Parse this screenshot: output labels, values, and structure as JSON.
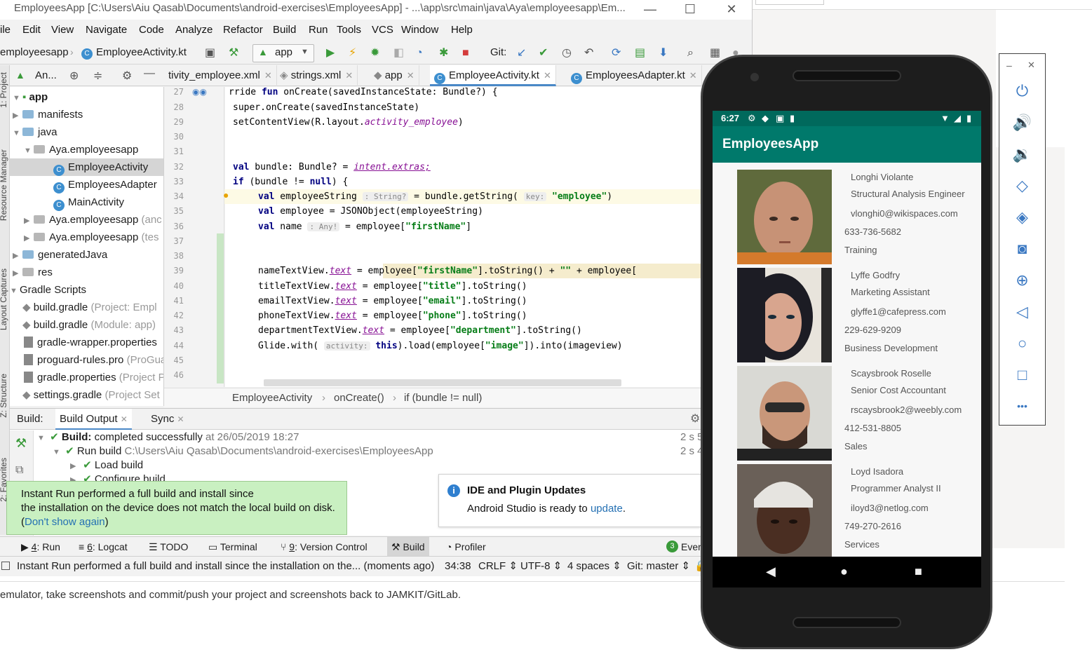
{
  "background": {
    "bottom_text": "emulator, take screenshots and commit/push your project and screenshots back to JAMKIT/GitLab."
  },
  "ide": {
    "title": "EmployeesApp [C:\\Users\\Aiu Qasab\\Documents\\android-exercises\\EmployeesApp] - ...\\app\\src\\main\\java\\Aya\\employeesapp\\Em...",
    "window_controls": {
      "minimize": "—",
      "maximize": "☐",
      "close": "✕"
    },
    "menu": [
      "ile",
      "Edit",
      "View",
      "Navigate",
      "Code",
      "Analyze",
      "Refactor",
      "Build",
      "Run",
      "Tools",
      "VCS",
      "Window",
      "Help"
    ],
    "toolbar": {
      "breadcrumb_root": "employeesapp",
      "breadcrumb_file": "EmployeeActivity.kt",
      "run_config": "app",
      "git_label": "Git:"
    },
    "editor_tabs": [
      {
        "label": "tivity_employee.xml",
        "active": false
      },
      {
        "label": "strings.xml",
        "active": false
      },
      {
        "label": "app",
        "active": false
      },
      {
        "label": "EmployeeActivity.kt",
        "active": true
      },
      {
        "label": "EmployeesAdapter.kt",
        "active": false
      }
    ],
    "project_pane": {
      "selector": "An...",
      "side_labels": [
        "1: Project",
        "Resource Manager",
        "Layout Captures",
        "Z: Structure",
        "2: Favorites"
      ],
      "tree": [
        {
          "label": "app",
          "hint": ""
        },
        {
          "label": "manifests",
          "hint": ""
        },
        {
          "label": "java",
          "hint": ""
        },
        {
          "label": "Aya.employeesapp",
          "hint": ""
        },
        {
          "label": "EmployeeActivity",
          "hint": ""
        },
        {
          "label": "EmployeesAdapter",
          "hint": ""
        },
        {
          "label": "MainActivity",
          "hint": ""
        },
        {
          "label": "Aya.employeesapp",
          "hint": "(anc"
        },
        {
          "label": "Aya.employeesapp",
          "hint": "(tes"
        },
        {
          "label": "generatedJava",
          "hint": ""
        },
        {
          "label": "res",
          "hint": ""
        },
        {
          "label": "Gradle Scripts",
          "hint": ""
        },
        {
          "label": "build.gradle",
          "hint": "(Project: Empl"
        },
        {
          "label": "build.gradle",
          "hint": "(Module: app)"
        },
        {
          "label": "gradle-wrapper.properties",
          "hint": ""
        },
        {
          "label": "proguard-rules.pro",
          "hint": "(ProGua"
        },
        {
          "label": "gradle.properties",
          "hint": "(Project P"
        },
        {
          "label": "settings.gradle",
          "hint": "(Project Set"
        }
      ]
    },
    "code": {
      "line_numbers": [
        "27",
        "28",
        "29",
        "30",
        "31",
        "32",
        "33",
        "34",
        "35",
        "36",
        "37",
        "38",
        "39",
        "40",
        "41",
        "42",
        "43",
        "44",
        "45",
        "46"
      ],
      "l27": {
        "a": "rride ",
        "kw": "fun",
        "b": " onCreate(savedInstanceState: Bundle?) {"
      },
      "l28": "super.onCreate(savedInstanceState)",
      "l29": {
        "a": "setContentView(R.layout.",
        "p": "activity_employee",
        "b": ")"
      },
      "l32": {
        "kw": "val",
        "a": " bundle: Bundle? = ",
        "p": "intent.extras;"
      },
      "l33": {
        "kw": "if",
        "a": " (bundle != ",
        "kw2": "null",
        "b": ") {"
      },
      "l34": {
        "kw": "val",
        "a": " employeeString ",
        "hint": ": String?",
        "b": " = bundle.getString( ",
        "hint2": "key:",
        "s": " \"employee\"",
        "c": ")"
      },
      "l35": {
        "kw": "val",
        "a": " employee = JSONObject(employeeString)"
      },
      "l36": {
        "kw": "val",
        "a": " name ",
        "hint": ": Any!",
        "b": " = employee[",
        "s": "\"firstName\"",
        "c": "]"
      },
      "l39": {
        "a": "nameTextView.",
        "p": "text",
        "b": " = employee[",
        "s": "\"firstName\"",
        "c": "].toString() + ",
        "s2": "\"\"",
        "d": " + employee["
      },
      "l40": {
        "a": "titleTextView.",
        "p": "text",
        "b": " = employee[",
        "s": "\"title\"",
        "c": "].toString()"
      },
      "l41": {
        "a": "emailTextView.",
        "p": "text",
        "b": " = employee[",
        "s": "\"email\"",
        "c": "].toString()"
      },
      "l42": {
        "a": "phoneTextView.",
        "p": "text",
        "b": " = employee[",
        "s": "\"phone\"",
        "c": "].toString()"
      },
      "l43": {
        "a": "departmentTextView.",
        "p": "text",
        "b": " = employee[",
        "s": "\"department\"",
        "c": "].toString()"
      },
      "l44": {
        "a": "Glide.with( ",
        "hint": "activity:",
        "kw": " this",
        "b": ").load(employee[",
        "s": "\"image\"",
        "c": "]).into(imageview)"
      }
    },
    "breadcrumb": [
      "EmployeeActivity",
      "onCreate()",
      "if (bundle != null)"
    ],
    "build": {
      "tabs": {
        "label": "Build:",
        "output": "Build Output",
        "sync": "Sync"
      },
      "line1_bold": "Build:",
      "line1_text": " completed successfully",
      "line1_time": " at 26/05/2019 18:27",
      "line1_dur": "2 s 5",
      "line2_text": "Run build",
      "line2_path": " C:\\Users\\Aiu Qasab\\Documents\\android-exercises\\EmployeesApp",
      "line2_dur": "2 s 4",
      "line3_text": "Load build",
      "line4_text": "Configure build"
    },
    "balloon": {
      "line1": "Instant Run performed a full build and install since",
      "line2": "the installation on the device does not match the local build on disk.",
      "open": "(",
      "link": "Don't show again",
      "close": ")"
    },
    "notification": {
      "title": "IDE and Plugin Updates",
      "body": "Android Studio is ready to ",
      "link": "update",
      "end": "."
    },
    "bottom_tools": [
      {
        "key": "4",
        "label": ": Run"
      },
      {
        "key": "6",
        "label": ": Logcat"
      },
      {
        "key": "",
        "label": "TODO"
      },
      {
        "key": "",
        "label": "Terminal"
      },
      {
        "key": "9",
        "label": ": Version Control"
      },
      {
        "key": "",
        "label": "Build"
      },
      {
        "key": "",
        "label": "Profiler"
      }
    ],
    "event_count": "3",
    "event_label": "Even",
    "status": {
      "message": "Instant Run performed a full build and install since the installation on the... (moments ago)",
      "position": "34:38",
      "line_sep": "CRLF",
      "encoding": "UTF-8",
      "indent": "4 spaces",
      "git": "Git: master"
    }
  },
  "emulator": {
    "status_time": "6:27",
    "app_title": "EmployeesApp",
    "employees": [
      {
        "name": "Longhi Violante",
        "title": "Structural Analysis Engineer",
        "email": "vlonghi0@wikispaces.com",
        "phone": "633-736-5682",
        "department": "Training"
      },
      {
        "name": "Lyffe Godfry",
        "title": "Marketing Assistant",
        "email": "glyffe1@cafepress.com",
        "phone": "229-629-9209",
        "department": "Business Development"
      },
      {
        "name": "Scaysbrook Roselle",
        "title": "Senior Cost Accountant",
        "email": "rscaysbrook2@weebly.com",
        "phone": "412-531-8805",
        "department": "Sales"
      },
      {
        "name": "Loyd Isadora",
        "title": "Programmer Analyst II",
        "email": "iloyd3@netlog.com",
        "phone": "749-270-2616",
        "department": "Services"
      }
    ],
    "nav": {
      "back": "◀",
      "home": "●",
      "recents": "■"
    },
    "panel": {
      "minimize": "–",
      "close": "✕",
      "more": "•••"
    }
  }
}
